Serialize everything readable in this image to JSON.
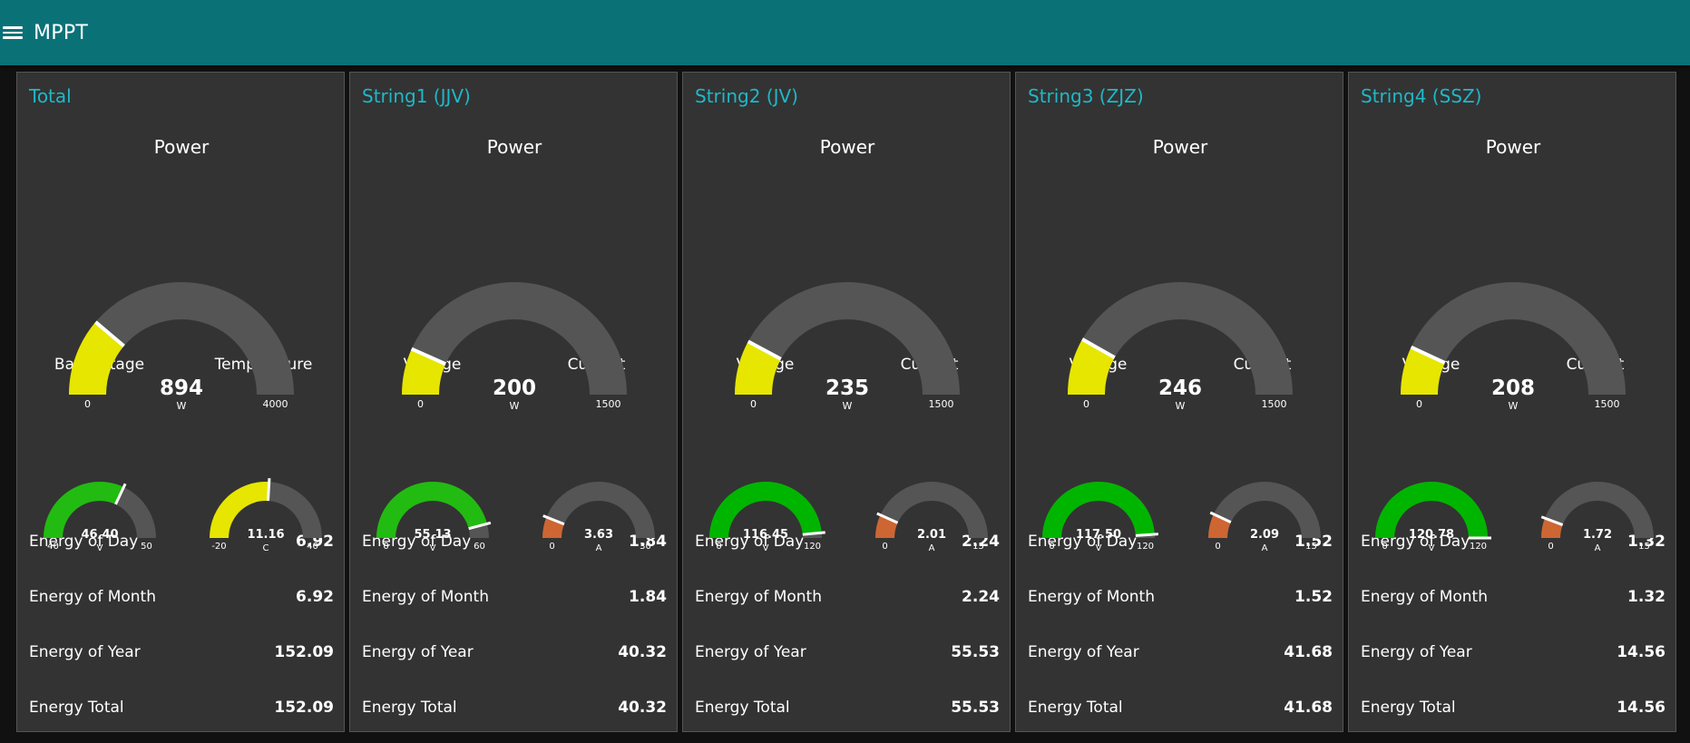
{
  "header": {
    "title": "MPPT",
    "menu_icon": "hamburger-menu-icon"
  },
  "colors": {
    "header_bg": "#0a7177",
    "card_bg": "#333333",
    "card_title": "#1fb8c8",
    "track": "#555555",
    "power_fill": "#e6e600",
    "voltage_fill": "#00b500",
    "current_fill": "#cd6633",
    "temperature_fill": "#e6e600"
  },
  "cards": [
    {
      "title": "Total",
      "power": {
        "label": "Power",
        "value": "894",
        "unit": "W",
        "min": "0",
        "max": "4000",
        "fraction": 0.2235,
        "color": "#e6e600"
      },
      "left": {
        "label": "BattVoltage",
        "value": "46.40",
        "unit": "V",
        "min": "40",
        "max": "50",
        "fraction": 0.64,
        "color": "#22bb11"
      },
      "right": {
        "label": "Temperature",
        "value": "11.16",
        "unit": "C",
        "min": "-20",
        "max": "40",
        "fraction": 0.519,
        "color": "#e6e600"
      },
      "stats": [
        {
          "label": "Energy of Day",
          "value": "6.92"
        },
        {
          "label": "Energy of Month",
          "value": "6.92"
        },
        {
          "label": "Energy of Year",
          "value": "152.09"
        },
        {
          "label": "Energy Total",
          "value": "152.09"
        }
      ]
    },
    {
      "title": "String1 (JJV)",
      "power": {
        "label": "Power",
        "value": "200",
        "unit": "W",
        "min": "0",
        "max": "1500",
        "fraction": 0.1333,
        "color": "#e6e600"
      },
      "left": {
        "label": "Voltage",
        "value": "55.13",
        "unit": "V",
        "min": "0",
        "max": "60",
        "fraction": 0.9188,
        "color": "#22bb11"
      },
      "right": {
        "label": "Current",
        "value": "3.63",
        "unit": "A",
        "min": "0",
        "max": "30",
        "fraction": 0.121,
        "color": "#cd6633"
      },
      "stats": [
        {
          "label": "Energy of Day",
          "value": "1.84"
        },
        {
          "label": "Energy of Month",
          "value": "1.84"
        },
        {
          "label": "Energy of Year",
          "value": "40.32"
        },
        {
          "label": "Energy Total",
          "value": "40.32"
        }
      ]
    },
    {
      "title": "String2 (JV)",
      "power": {
        "label": "Power",
        "value": "235",
        "unit": "W",
        "min": "0",
        "max": "1500",
        "fraction": 0.1567,
        "color": "#e6e600"
      },
      "left": {
        "label": "Voltage",
        "value": "116.45",
        "unit": "V",
        "min": "0",
        "max": "120",
        "fraction": 0.9704,
        "color": "#00b500"
      },
      "right": {
        "label": "Current",
        "value": "2.01",
        "unit": "A",
        "min": "0",
        "max": "15",
        "fraction": 0.134,
        "color": "#cd6633"
      },
      "stats": [
        {
          "label": "Energy of Day",
          "value": "2.24"
        },
        {
          "label": "Energy of Month",
          "value": "2.24"
        },
        {
          "label": "Energy of Year",
          "value": "55.53"
        },
        {
          "label": "Energy Total",
          "value": "55.53"
        }
      ]
    },
    {
      "title": "String3 (ZJZ)",
      "power": {
        "label": "Power",
        "value": "246",
        "unit": "W",
        "min": "0",
        "max": "1500",
        "fraction": 0.164,
        "color": "#e6e600"
      },
      "left": {
        "label": "Voltage",
        "value": "117.50",
        "unit": "V",
        "min": "0",
        "max": "120",
        "fraction": 0.9792,
        "color": "#00b500"
      },
      "right": {
        "label": "Current",
        "value": "2.09",
        "unit": "A",
        "min": "0",
        "max": "15",
        "fraction": 0.1393,
        "color": "#cd6633"
      },
      "stats": [
        {
          "label": "Energy of Day",
          "value": "1.52"
        },
        {
          "label": "Energy of Month",
          "value": "1.52"
        },
        {
          "label": "Energy of Year",
          "value": "41.68"
        },
        {
          "label": "Energy Total",
          "value": "41.68"
        }
      ]
    },
    {
      "title": "String4 (SSZ)",
      "power": {
        "label": "Power",
        "value": "208",
        "unit": "W",
        "min": "0",
        "max": "1500",
        "fraction": 0.1387,
        "color": "#e6e600"
      },
      "left": {
        "label": "Voltage",
        "value": "120.78",
        "unit": "V",
        "min": "0",
        "max": "120",
        "fraction": 1.0,
        "color": "#00b500"
      },
      "right": {
        "label": "Current",
        "value": "1.72",
        "unit": "A",
        "min": "0",
        "max": "15",
        "fraction": 0.1147,
        "color": "#cd6633"
      },
      "stats": [
        {
          "label": "Energy of Day",
          "value": "1.32"
        },
        {
          "label": "Energy of Month",
          "value": "1.32"
        },
        {
          "label": "Energy of Year",
          "value": "14.56"
        },
        {
          "label": "Energy Total",
          "value": "14.56"
        }
      ]
    }
  ]
}
